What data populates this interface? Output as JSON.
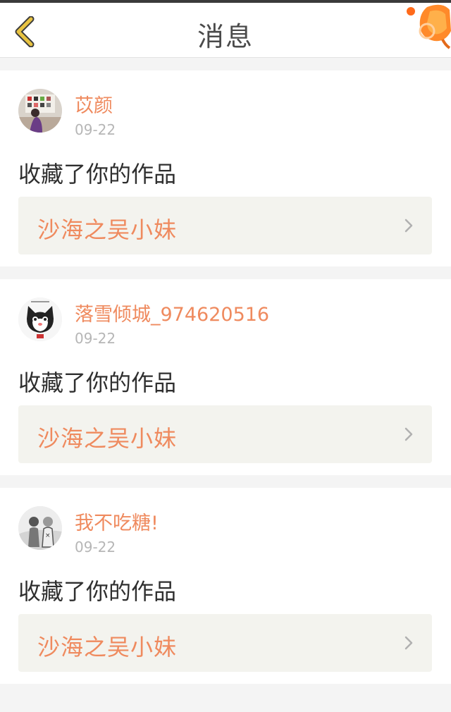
{
  "header": {
    "title": "消息",
    "back_icon": "chevron-left-icon",
    "decor_icon": "balloon-lantern-icon"
  },
  "colors": {
    "accent": "#ef8a5e",
    "back_icon": "#e8c341",
    "card_link_bg": "#f3f3ee",
    "page_bg": "#f4f4f4"
  },
  "messages": [
    {
      "user": "苡颜",
      "time": "09-22",
      "action": "收藏了你的作品",
      "work": "沙海之吴小妹",
      "avatar_icon": "avatar-photo-icon"
    },
    {
      "user": "落雪倾城_974620516",
      "time": "09-22",
      "action": "收藏了你的作品",
      "work": "沙海之吴小妹",
      "avatar_icon": "avatar-cat-icon"
    },
    {
      "user": "我不吃糖!",
      "time": "09-22",
      "action": "收藏了你的作品",
      "work": "沙海之吴小妹",
      "avatar_icon": "avatar-sketch-icon"
    }
  ]
}
